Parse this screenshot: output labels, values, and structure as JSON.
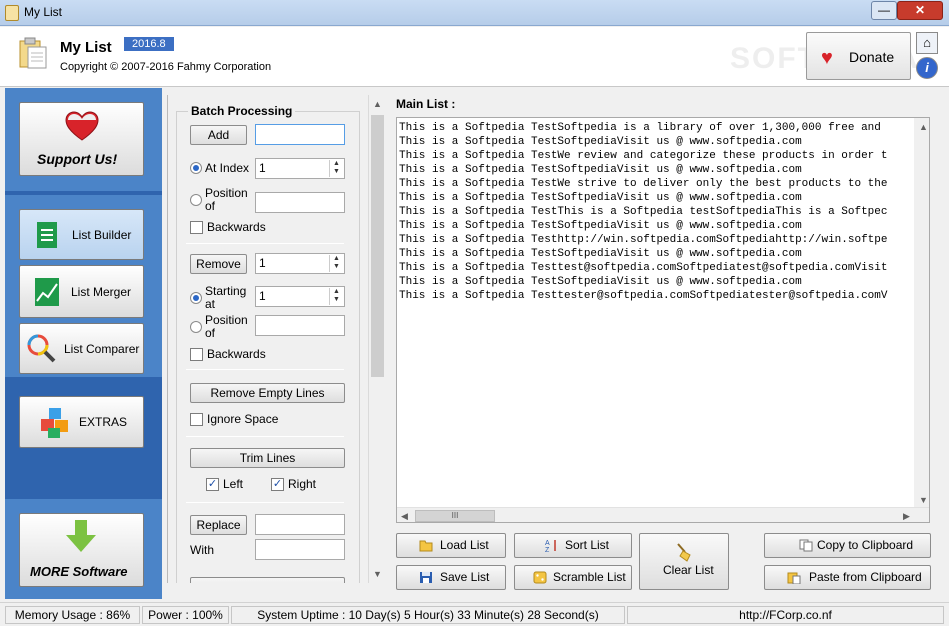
{
  "window": {
    "title": "My List",
    "minimize": "—",
    "close": "✕"
  },
  "header": {
    "app_name": "My List",
    "version": "2016.8",
    "copyright": "Copyright © 2007-2016 Fahmy Corporation",
    "watermark": "SOFTPEDIA",
    "donate_label": "Donate",
    "home_icon": "⌂",
    "info_icon": "i"
  },
  "sidebar": {
    "support": "Support Us!",
    "list_builder": "List Builder",
    "list_merger": "List Merger",
    "list_comparer": "List Comparer",
    "extras": "EXTRAS",
    "more_software": "MORE Software"
  },
  "batch": {
    "title": "Batch Processing",
    "add_label": "Add",
    "add_value": "",
    "at_index_label": "At Index",
    "at_index_value": "1",
    "position_of_label": "Position of",
    "position_of_value": "",
    "backwards1_label": "Backwards",
    "remove_label": "Remove",
    "remove_value": "1",
    "starting_at_label": "Starting at",
    "starting_at_value": "1",
    "position_of2_label": "Position of",
    "position_of2_value": "",
    "backwards2_label": "Backwards",
    "remove_empty_label": "Remove Empty Lines",
    "ignore_space_label": "Ignore Space",
    "trim_label": "Trim Lines",
    "left_label": "Left",
    "right_label": "Right",
    "replace_label": "Replace",
    "replace_value": "",
    "with_label": "With",
    "with_value": ""
  },
  "main": {
    "label": "Main List :",
    "lines": [
      "This is a Softpedia TestSoftpedia is a library of over 1,300,000 free and",
      "This is a Softpedia TestSoftpediaVisit us @ www.softpedia.com",
      "This is a Softpedia TestWe review and categorize these products in order t",
      "This is a Softpedia TestSoftpediaVisit us @ www.softpedia.com",
      "This is a Softpedia TestWe strive to deliver only the best products to the",
      "This is a Softpedia TestSoftpediaVisit us @ www.softpedia.com",
      "This is a Softpedia TestThis is a Softpedia testSoftpediaThis is a Softpec",
      "This is a Softpedia TestSoftpediaVisit us @ www.softpedia.com",
      "This is a Softpedia Testhttp://win.softpedia.comSoftpediahttp://win.softpe",
      "This is a Softpedia TestSoftpediaVisit us @ www.softpedia.com",
      "This is a Softpedia Testtest@softpedia.comSoftpediatest@softpedia.comVisit",
      "This is a Softpedia TestSoftpediaVisit us @ www.softpedia.com",
      "This is a Softpedia Testtester@softpedia.comSoftpediatester@softpedia.comV"
    ],
    "hscroll_thumb": "III"
  },
  "actions": {
    "load": "Load List",
    "save": "Save List",
    "sort": "Sort List",
    "scramble": "Scramble List",
    "clear": "Clear List",
    "copy": "Copy to Clipboard",
    "paste": "Paste from Clipboard"
  },
  "status": {
    "memory": "Memory Usage : 86%",
    "power": "Power : 100%",
    "uptime": "System Uptime : 10 Day(s) 5 Hour(s) 33 Minute(s) 28 Second(s)",
    "url": "http://FCorp.co.nf"
  },
  "colors": {
    "accent": "#2f64ae",
    "version_bg": "#3c6fc3",
    "heart": "#d8232a"
  }
}
